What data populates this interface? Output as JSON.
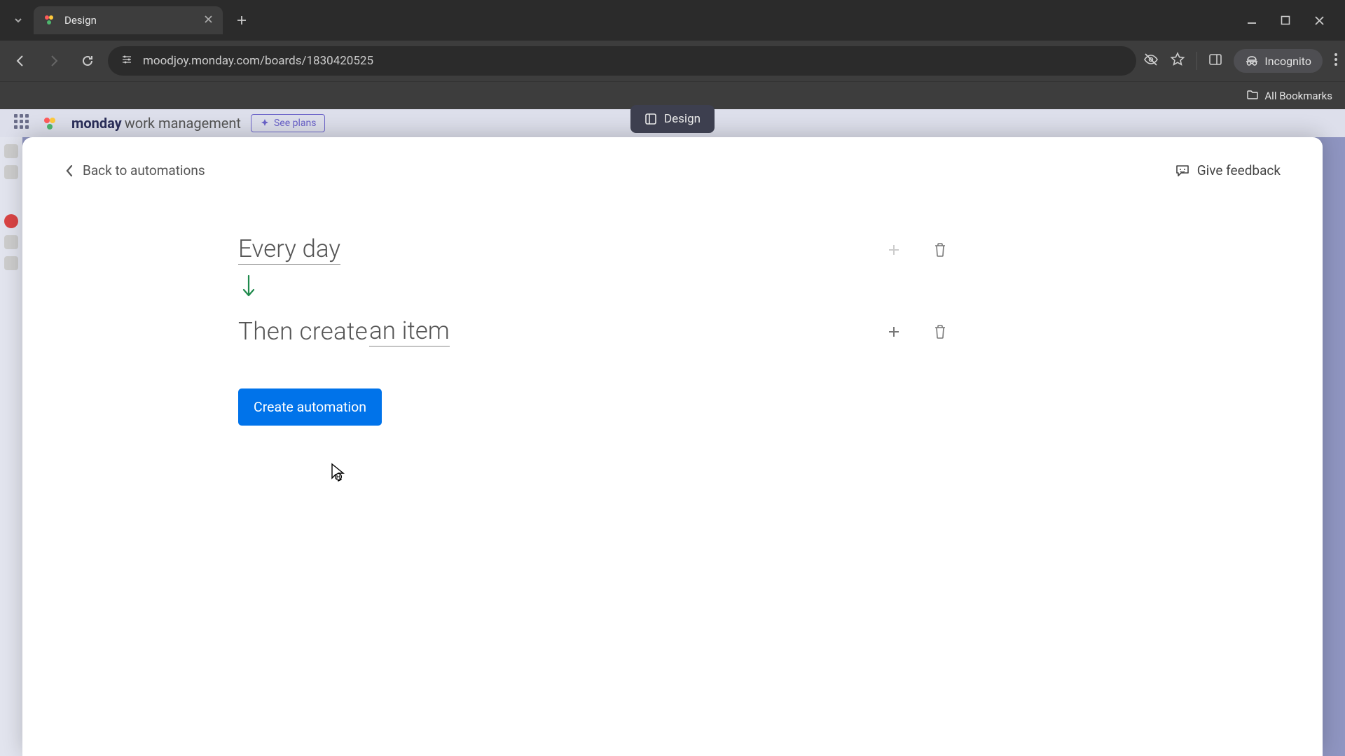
{
  "browser": {
    "tab_title": "Design",
    "url": "moodjoy.monday.com/boards/1830420525",
    "incognito_label": "Incognito",
    "all_bookmarks": "All Bookmarks"
  },
  "app": {
    "brand_bold": "monday",
    "brand_light": "work management",
    "see_plans": "See plans",
    "top_pill": "Design"
  },
  "modal": {
    "back_label": "Back to automations",
    "feedback_label": "Give feedback",
    "trigger_text": "Every day",
    "action_prefix": "Then create ",
    "action_link": "an item",
    "create_button": "Create automation"
  }
}
